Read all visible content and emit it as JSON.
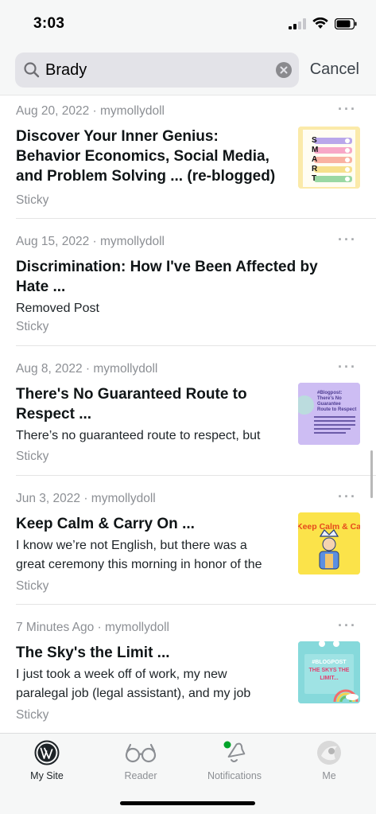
{
  "status_bar": {
    "time": "3:03"
  },
  "search": {
    "query": "Brady",
    "cancel_label": "Cancel"
  },
  "posts": [
    {
      "meta": "Aug 20, 2022 · mymollydoll",
      "title_lines": [
        "Discover Your Inner Genius:",
        "Behavior Economics, Social Media,",
        "and Problem Solving ... (re-blogged)"
      ],
      "excerpt_lines": [],
      "status": "Sticky",
      "thumb_text": [
        "S",
        "M",
        "A",
        "R",
        "T"
      ]
    },
    {
      "meta": "Aug 15, 2022 · mymollydoll",
      "title_lines": [
        "Discrimination: How I've Been Affected by",
        "Hate ..."
      ],
      "excerpt_lines": [
        "Removed Post"
      ],
      "status": "Sticky"
    },
    {
      "meta": "Aug 8, 2022 · mymollydoll",
      "title_lines": [
        "There's No Guaranteed Route to",
        "Respect ..."
      ],
      "excerpt_lines": [
        "There’s no guaranteed route to respect, but"
      ],
      "status": "Sticky",
      "thumb_text": [
        "#Blogpost:",
        "There's No Guarantee",
        "Route to Respect"
      ]
    },
    {
      "meta": "Jun 3, 2022 · mymollydoll",
      "title_lines": [
        "Keep Calm & Carry On ..."
      ],
      "excerpt_lines": [
        "I know we’re not English, but there was a",
        "great ceremony this morning in honor of the"
      ],
      "status": "Sticky",
      "thumb_text": [
        "Keep Calm & Ca"
      ]
    },
    {
      "meta": "7 Minutes Ago · mymollydoll",
      "title_lines": [
        "The Sky's the Limit ..."
      ],
      "excerpt_lines": [
        "I just took a week off of work, my new",
        "paralegal job (legal assistant), and my job"
      ],
      "status": "Sticky",
      "thumb_text": [
        "#BLOGPOST",
        "THE SKYS THE",
        "LIMIT..."
      ]
    }
  ],
  "tabs": [
    {
      "label": "My Site",
      "icon": "wordpress-icon",
      "active": true
    },
    {
      "label": "Reader",
      "icon": "reader-glasses-icon",
      "active": false
    },
    {
      "label": "Notifications",
      "icon": "bell-icon",
      "active": false
    },
    {
      "label": "Me",
      "icon": "avatar",
      "active": false
    }
  ],
  "colors": {
    "accent_green": "#00a32a",
    "text_secondary": "#8c8f94",
    "background": "#f6f7f7"
  }
}
